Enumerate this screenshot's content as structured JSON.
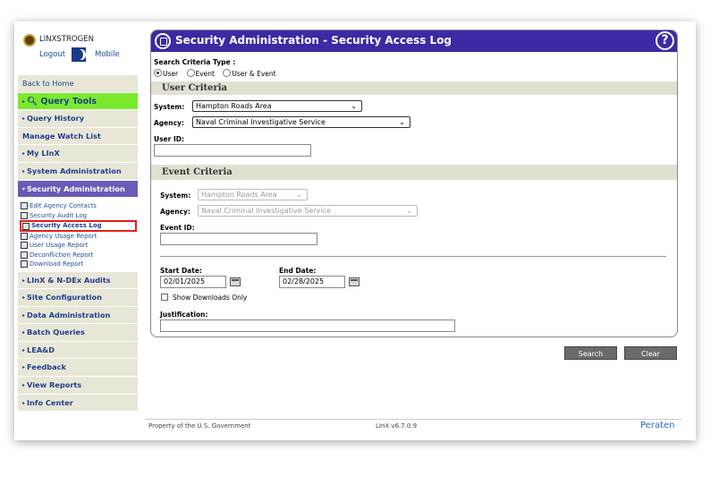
{
  "brand": {
    "name": "LINXSTROGEN",
    "logout": "Logout",
    "mobile": "Mobile"
  },
  "nav": {
    "back": "Back to Home",
    "query_tools": "Query Tools",
    "query_history": "Query History",
    "watch_list": "Manage Watch List",
    "my_linx": "My LInX",
    "system_admin": "System Administration",
    "security_admin": "Security Administration",
    "sub": [
      "Edit Agency Contacts",
      "Security Audit Log",
      "Security Access Log",
      "Agency Usage Report",
      "User Usage Report",
      "Deconfliction Report",
      "Download Report"
    ],
    "linx_audits": "LInX & N-DEx Audits",
    "site_config": "Site Configuration",
    "data_admin": "Data Administration",
    "batch_queries": "Batch Queries",
    "lead": "LEA&D",
    "feedback": "Feedback",
    "view_reports": "View Reports",
    "info_center": "Info Center"
  },
  "panel": {
    "title": "Security Administration - Security Access Log",
    "help": "?",
    "search_type_label": "Search Criteria Type :",
    "radio": [
      "User",
      "Event",
      "User & Event"
    ],
    "user_criteria": "User Criteria",
    "system_label": "System:",
    "system_value": "Hampton Roads Area",
    "agency_label": "Agency:",
    "agency_value": "Naval Criminal Investigative Service",
    "user_id_label": "User ID:",
    "event_criteria": "Event Criteria",
    "ev_system_label": "System:",
    "ev_system_value": "Hampton Roads Area",
    "ev_agency_label": "Agency:",
    "ev_agency_value": "Naval Criminal Investigative Service",
    "event_id_label": "Event ID:",
    "start_label": "Start Date:",
    "start_value": "02/01/2025",
    "end_label": "End Date:",
    "end_value": "02/28/2025",
    "downloads_only": "Show Downloads Only",
    "justification_label": "Justification:"
  },
  "buttons": {
    "search": "Search",
    "clear": "Clear"
  },
  "footer": {
    "left": "Property of the U.S. Government",
    "version": "LInX v6.7.0.9",
    "company": "Peraten"
  }
}
